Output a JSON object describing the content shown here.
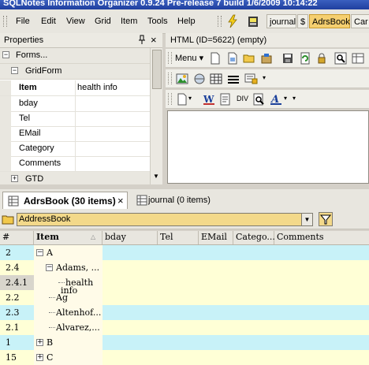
{
  "app": {
    "title": "SQLNotes Information Organizer 0.9.24 Pre-release 7 build 1/6/2009 10:14:22"
  },
  "menubar": {
    "items": [
      "File",
      "Edit",
      "View",
      "Grid",
      "Item",
      "Tools",
      "Help"
    ],
    "tabs": [
      {
        "label": "journal",
        "active": false
      },
      {
        "label": "$",
        "active": false
      },
      {
        "label": "AdrsBook",
        "active": true
      },
      {
        "label": "Car",
        "active": false
      }
    ]
  },
  "properties": {
    "title": "Properties",
    "pin_glyph": "ᵠ",
    "close_glyph": "×",
    "sections": [
      {
        "label": "Forms...",
        "expanded": true
      },
      {
        "label": "GridForm",
        "expanded": true
      },
      {
        "label": "GTD",
        "expanded": false
      }
    ],
    "columns": {
      "name": "Item",
      "value": "health info"
    },
    "rows": [
      "bday",
      "Tel",
      "EMail",
      "Category",
      "Comments"
    ]
  },
  "html_pane": {
    "title": "HTML (ID=5622) (empty)",
    "menu_label": "Menu",
    "div_label": "DIV"
  },
  "doc_tabs": [
    {
      "label": "AdrsBook (30 items)",
      "active": true
    },
    {
      "label": "journal (0 items)",
      "active": false
    }
  ],
  "path": {
    "value": "AddressBook"
  },
  "list": {
    "headers": [
      "#",
      "Item",
      "bday",
      "Tel",
      "EMail",
      "Catego...",
      "Comments"
    ],
    "rows": [
      {
        "num": "2",
        "item": "A",
        "indent": 0,
        "toggle": "minus",
        "color": "#c8f2f8"
      },
      {
        "num": "2.4",
        "item": "Adams, ...",
        "indent": 1,
        "toggle": "minus",
        "color": "#ffffd6"
      },
      {
        "num": "2.4.1",
        "item": "health",
        "item2": "info",
        "indent": 2,
        "toggle": "none",
        "color": "#ffffd6"
      },
      {
        "num": "2.2",
        "item": "Ag",
        "indent": 1,
        "toggle": "none",
        "color": "#ffffd6"
      },
      {
        "num": "2.3",
        "item": "Altenhof...",
        "indent": 1,
        "toggle": "none",
        "color": "#c8f2f8"
      },
      {
        "num": "2.1",
        "item": "Alvarez,...",
        "indent": 1,
        "toggle": "none",
        "color": "#ffffd6"
      },
      {
        "num": "1",
        "item": "B",
        "indent": 0,
        "toggle": "plus",
        "color": "#c8f2f8"
      },
      {
        "num": "15",
        "item": "C",
        "indent": 0,
        "toggle": "plus",
        "color": "#ffffd6"
      }
    ]
  },
  "colors": {
    "title_bar": "#2a4cad",
    "active_tab": "#f5cf70",
    "path_combo": "#f3d98a",
    "row_cyan": "#c8f2f8",
    "row_yellow": "#ffffd6"
  },
  "icons": [
    "lightning-icon",
    "gauge-icon",
    "new-doc-icon",
    "open-folder-icon",
    "save-icon",
    "refresh-icon",
    "lock-icon",
    "find-icon",
    "image-icon",
    "table-icon",
    "hr-icon",
    "word-icon",
    "spell-icon",
    "font-color-icon",
    "filter-icon"
  ]
}
